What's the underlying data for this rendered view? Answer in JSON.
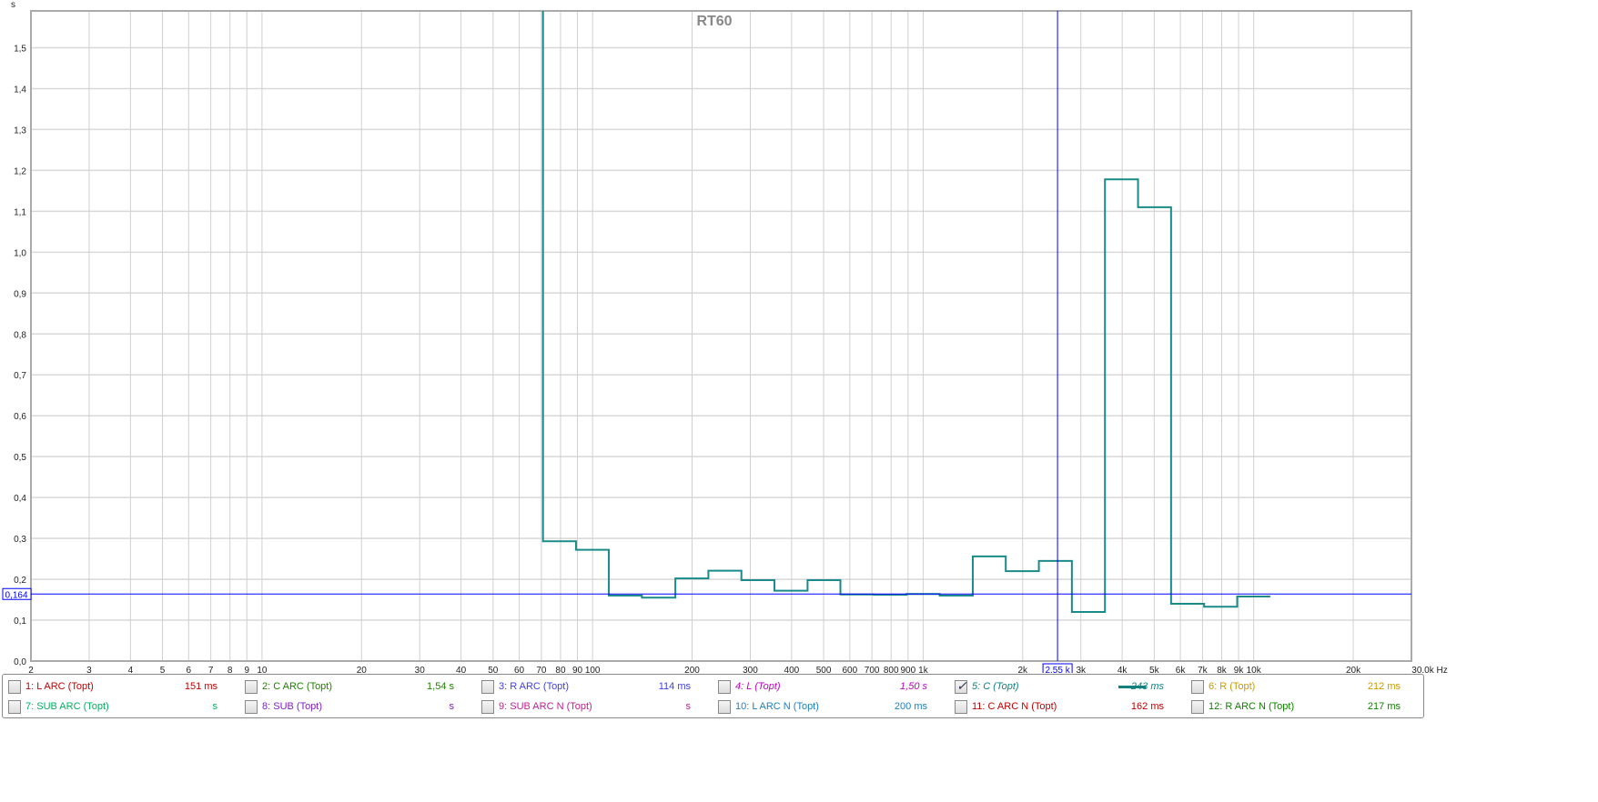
{
  "chart_data": {
    "type": "line",
    "title": "RT60",
    "ylabel": "s",
    "xunit": "Hz",
    "xscale": "log",
    "xlim": [
      2,
      30000
    ],
    "ylim": [
      0,
      1.59
    ],
    "grid": true,
    "yticks": [
      "0,0",
      "0,1",
      "0,2",
      "0,3",
      "0,4",
      "0,5",
      "0,6",
      "0,7",
      "0,8",
      "0,9",
      "1,0",
      "1,1",
      "1,2",
      "1,3",
      "1,4",
      "1,5"
    ],
    "xticks": [
      {
        "v": 2,
        "l": "2"
      },
      {
        "v": 3,
        "l": "3"
      },
      {
        "v": 4,
        "l": "4"
      },
      {
        "v": 5,
        "l": "5"
      },
      {
        "v": 6,
        "l": "6"
      },
      {
        "v": 7,
        "l": "7"
      },
      {
        "v": 8,
        "l": "8"
      },
      {
        "v": 9,
        "l": "9"
      },
      {
        "v": 10,
        "l": "10"
      },
      {
        "v": 20,
        "l": "20"
      },
      {
        "v": 30,
        "l": "30"
      },
      {
        "v": 40,
        "l": "40"
      },
      {
        "v": 50,
        "l": "50"
      },
      {
        "v": 60,
        "l": "60"
      },
      {
        "v": 70,
        "l": "70"
      },
      {
        "v": 80,
        "l": "80"
      },
      {
        "v": 90,
        "l": "90"
      },
      {
        "v": 100,
        "l": "100"
      },
      {
        "v": 200,
        "l": "200"
      },
      {
        "v": 300,
        "l": "300"
      },
      {
        "v": 400,
        "l": "400"
      },
      {
        "v": 500,
        "l": "500"
      },
      {
        "v": 600,
        "l": "600"
      },
      {
        "v": 700,
        "l": "700"
      },
      {
        "v": 800,
        "l": "800"
      },
      {
        "v": 900,
        "l": "900"
      },
      {
        "v": 1000,
        "l": "1k"
      },
      {
        "v": 2000,
        "l": "2k"
      },
      {
        "v": 3000,
        "l": "3k"
      },
      {
        "v": 4000,
        "l": "4k"
      },
      {
        "v": 5000,
        "l": "5k"
      },
      {
        "v": 6000,
        "l": "6k"
      },
      {
        "v": 7000,
        "l": "7k"
      },
      {
        "v": 8000,
        "l": "8k"
      },
      {
        "v": 9000,
        "l": "9k"
      },
      {
        "v": 10000,
        "l": "10k"
      },
      {
        "v": 20000,
        "l": "20k"
      },
      {
        "v": 30000,
        "l": "30,0k Hz"
      }
    ],
    "series": [
      {
        "color": "#1a8a8a",
        "band_edges_hz": [
          70.8,
          89.1,
          112,
          141,
          178,
          224,
          282,
          355,
          447,
          562,
          708,
          891,
          1122,
          1413,
          1778,
          2239,
          2818,
          3548,
          4467,
          5623,
          7079,
          8913,
          11220
        ],
        "values": [
          0.293,
          0.272,
          0.16,
          0.155,
          0.202,
          0.221,
          0.198,
          0.172,
          0.198,
          0.163,
          0.162,
          0.164,
          0.16,
          0.256,
          0.22,
          0.245,
          0.12,
          1.178,
          1.11,
          0.14,
          0.133,
          0.158
        ],
        "offscale_below_first_edge": true
      }
    ],
    "cursor": {
      "x_label": "2,55 k",
      "x_value": 2550,
      "y_label": "0,164",
      "y_value": 0.164,
      "color": "#0000ff"
    }
  },
  "legend": [
    {
      "label": "1: L ARC (Topt)",
      "value": "151 ms",
      "color": "#c00000",
      "checked": false,
      "italic": false
    },
    {
      "label": "2: C ARC (Topt)",
      "value": "1,54 s",
      "color": "#208000",
      "checked": false,
      "italic": false
    },
    {
      "label": "3: R  ARC (Topt)",
      "value": "114 ms",
      "color": "#4040e0",
      "checked": false,
      "italic": false
    },
    {
      "label": "4: L (Topt)",
      "value": "1,50 s",
      "color": "#c000c0",
      "checked": false,
      "italic": true
    },
    {
      "label": "5: C (Topt)",
      "value": "243 ms",
      "color": "#108080",
      "checked": true,
      "italic": true
    },
    {
      "label": "6: R (Topt)",
      "value": "212 ms",
      "color": "#c89a00",
      "checked": false,
      "italic": false
    },
    {
      "label": "7: SUB ARC (Topt)",
      "value": "s",
      "color": "#00b060",
      "checked": false,
      "italic": false
    },
    {
      "label": "8: SUB (Topt)",
      "value": "s",
      "color": "#8020c0",
      "checked": false,
      "italic": false
    },
    {
      "label": "9: SUB ARC N (Topt)",
      "value": "s",
      "color": "#c02090",
      "checked": false,
      "italic": false
    },
    {
      "label": "10: L ARC N (Topt)",
      "value": "200 ms",
      "color": "#2080c0",
      "checked": false,
      "italic": false
    },
    {
      "label": "11: C ARC  N (Topt)",
      "value": "162 ms",
      "color": "#c00000",
      "checked": false,
      "italic": false
    },
    {
      "label": "12: R ARC  N (Topt)",
      "value": "217 ms",
      "color": "#108000",
      "checked": false,
      "italic": false
    }
  ]
}
